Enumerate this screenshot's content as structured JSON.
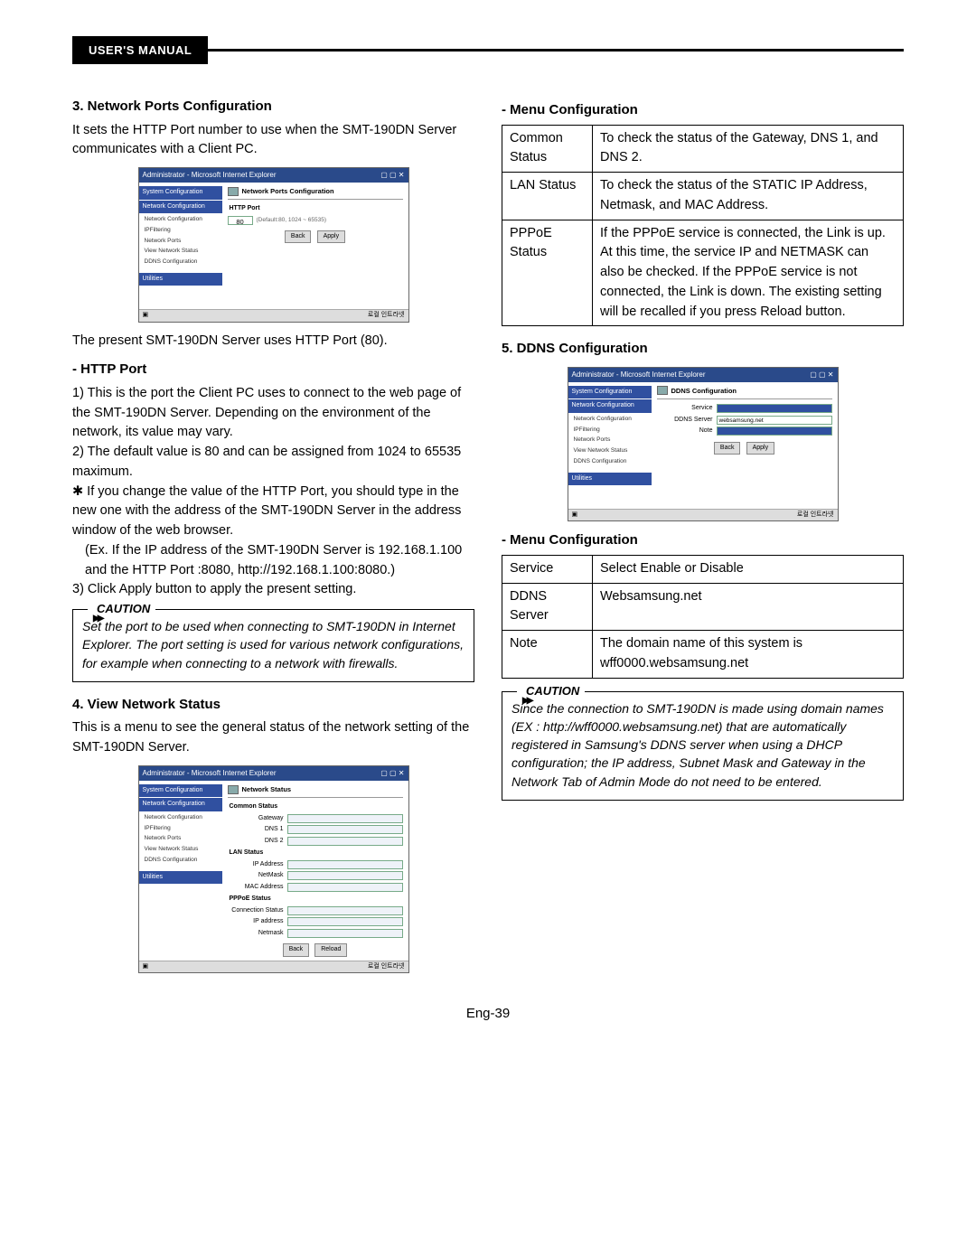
{
  "header": {
    "badge": "USER'S MANUAL"
  },
  "page_number": "Eng-39",
  "left": {
    "s3": {
      "title": "3. Network Ports Configuration",
      "intro": "It sets the HTTP Port number to use when the SMT-190DN Server communicates with a Client PC.",
      "afterimg": "The present SMT-190DN Server uses HTTP Port (80).",
      "http_heading": "-  HTTP Port",
      "p1": "1) This is the port the Client PC uses to connect to the web page of the SMT-190DN Server. Depending on the environment of the network, its value may vary.",
      "p2": "2) The default value is 80 and can be assigned from 1024 to 65535 maximum.",
      "p3": "✱ If you change the value of the HTTP Port, you should type in the new one with the address of the SMT-190DN Server in the address window of the web browser.",
      "p3b": "(Ex. If the IP address of the SMT-190DN Server is 192.168.1.100 and the HTTP Port :8080, http://192.168.1.100:8080.)",
      "p4": "3) Click Apply button to apply the present setting.",
      "caution_label": "CAUTION",
      "caution": "Set the port to be used when connecting to SMT-190DN in Internet Explorer. The port setting is used for various network configurations, for example when connecting to a network with firewalls."
    },
    "s4": {
      "title": "4. View Network Status",
      "intro": "This is a menu to see the general status of the network setting of the SMT-190DN Server."
    },
    "ss_ports": {
      "winTitle": "Administrator - Microsoft Internet Explorer",
      "panelTitle": "Network Ports Configuration",
      "httpPortLabel": "HTTP Port",
      "httpPortVal": "80",
      "defaultNote": "(Default:80, 1024 ~ 65535)",
      "btnBack": "Back",
      "btnApply": "Apply",
      "status": "로컬 인트라넷"
    },
    "ss_status": {
      "winTitle": "Administrator - Microsoft Internet Explorer",
      "panelTitle": "Network Status",
      "g1": "Common Status",
      "g1a": "Gateway",
      "g1b": "DNS 1",
      "g1c": "DNS 2",
      "g2": "LAN Status",
      "g2a": "IP Address",
      "g2b": "NetMask",
      "g2c": "MAC Address",
      "g3": "PPPoE Status",
      "g3a": "Connection Status",
      "g3b": "IP address",
      "g3c": "Netmask",
      "btnBack": "Back",
      "btnReload": "Reload",
      "status": "로컬 인트라넷"
    },
    "sidebar": {
      "h1": "System Configuration",
      "h2": "Network Configuration",
      "i1": "Network Configuration",
      "i2": "IPFiltering",
      "i3": "Network Ports",
      "i4": "View Network Status",
      "i5": "DDNS Configuration",
      "h3": "Utilities"
    }
  },
  "right": {
    "menu1_heading": "-  Menu Configuration",
    "table1": [
      [
        "Common Status",
        "To check the status of the Gateway, DNS 1, and DNS 2."
      ],
      [
        "LAN Status",
        "To check the status of the STATIC IP Address, Netmask, and MAC Address."
      ],
      [
        "PPPoE Status",
        "If the PPPoE service is connected, the Link is up. At this time, the service IP and NETMASK can also be checked. If the PPPoE service is not connected, the Link is down. The existing setting will be recalled if you press Reload button."
      ]
    ],
    "s5_title": "5. DDNS Configuration",
    "menu2_heading": "-  Menu Configuration",
    "table2": [
      [
        "Service",
        "Select Enable or Disable"
      ],
      [
        "DDNS Server",
        "Websamsung.net"
      ],
      [
        "Note",
        "The domain name of this system is wff0000.websamsung.net"
      ]
    ],
    "caution_label": "CAUTION",
    "caution": "Since the connection to SMT-190DN is made using domain names (EX : http://wff0000.websamsung.net) that are automatically registered in Samsung's DDNS server when using a DHCP configuration; the IP address, Subnet Mask and Gateway in the Network Tab of Admin Mode do not need to be entered.",
    "ss_ddns": {
      "winTitle": "Administrator - Microsoft Internet Explorer",
      "panelTitle": "DDNS Configuration",
      "r1": "Service",
      "r2": "DDNS Server",
      "r3": "Note",
      "v2": "websamsung.net",
      "btnBack": "Back",
      "btnApply": "Apply",
      "status": "로컬 인트라넷"
    }
  }
}
